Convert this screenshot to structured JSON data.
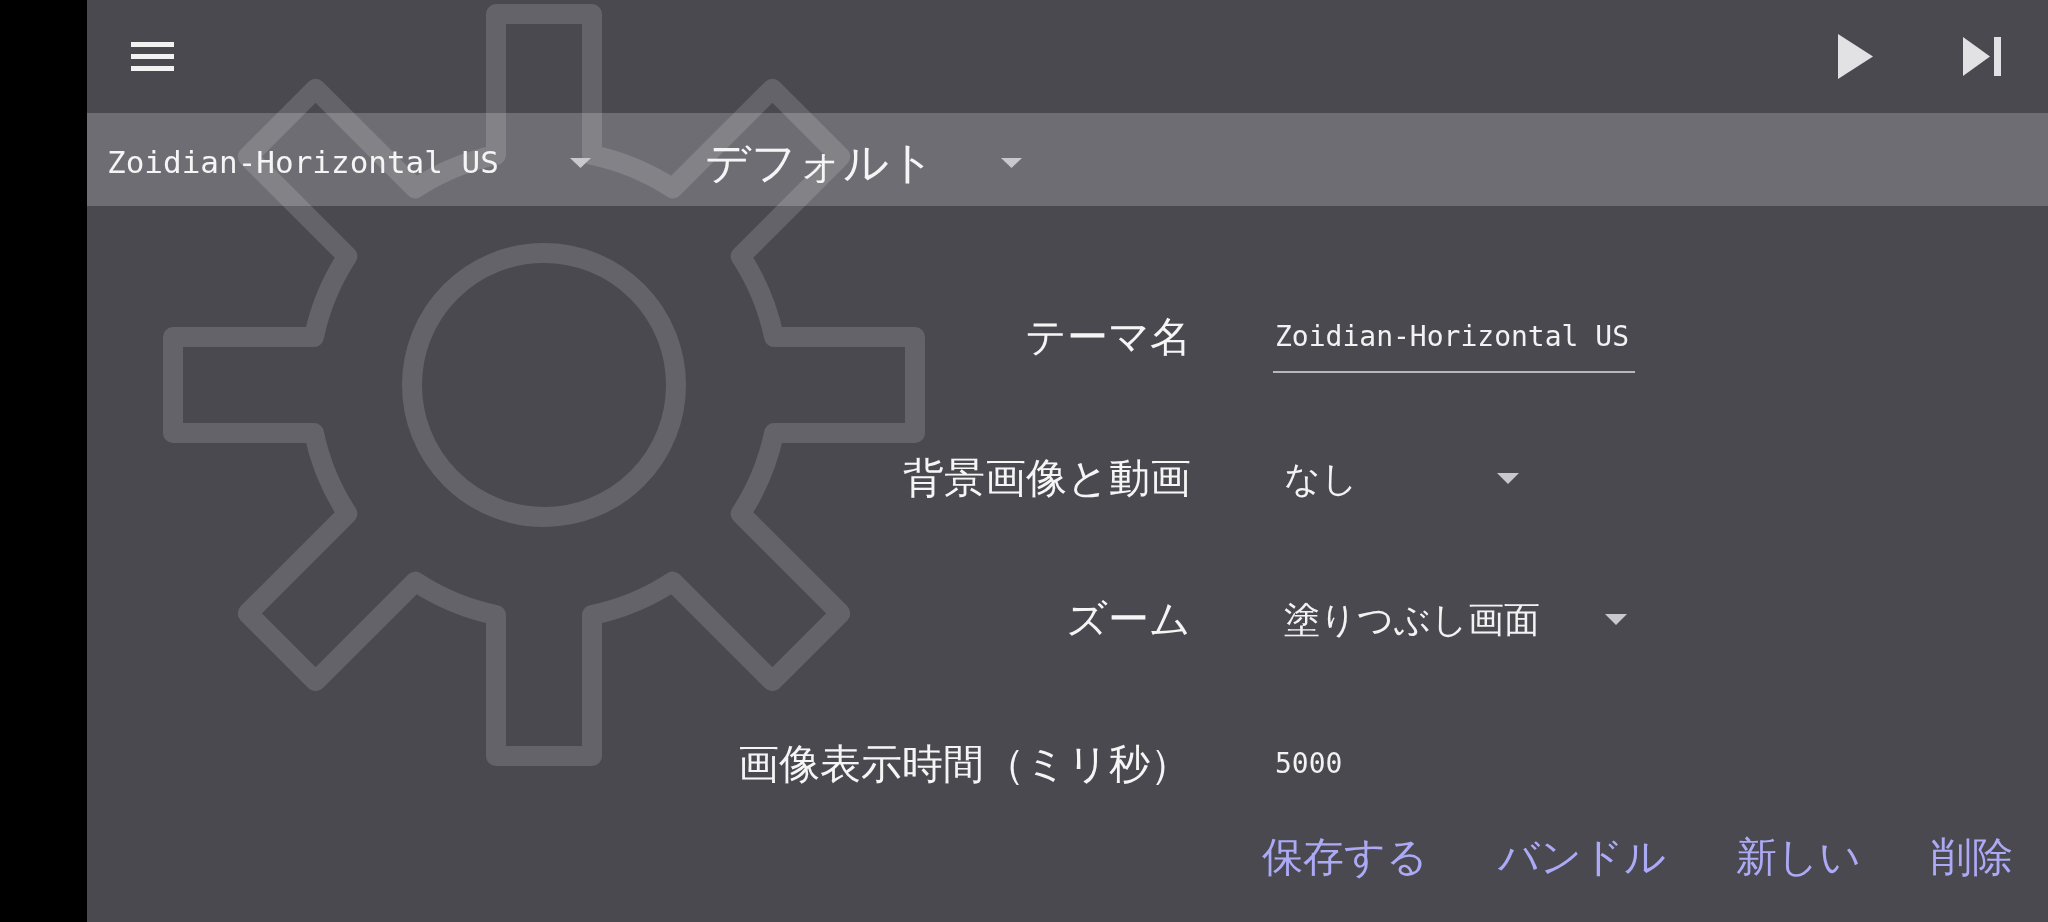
{
  "selector_bar": {
    "dropdowns": [
      {
        "kind": "theme",
        "value": "Zoidian-Horizontal US"
      },
      {
        "kind": "preset",
        "value": "デフォルト"
      }
    ]
  },
  "form": {
    "fields": [
      {
        "kind": "text",
        "label": "テーマ名",
        "value": "Zoidian-Horizontal US"
      },
      {
        "kind": "dropdown",
        "label": "背景画像と動画",
        "value": "なし"
      },
      {
        "kind": "dropdown",
        "label": "ズーム",
        "value": "塗りつぶし画面"
      },
      {
        "kind": "text",
        "label": "画像表示時間（ミリ秒）",
        "value": "5000"
      }
    ]
  },
  "actions": [
    "保存する",
    "バンドル",
    "新しい",
    "削除"
  ]
}
